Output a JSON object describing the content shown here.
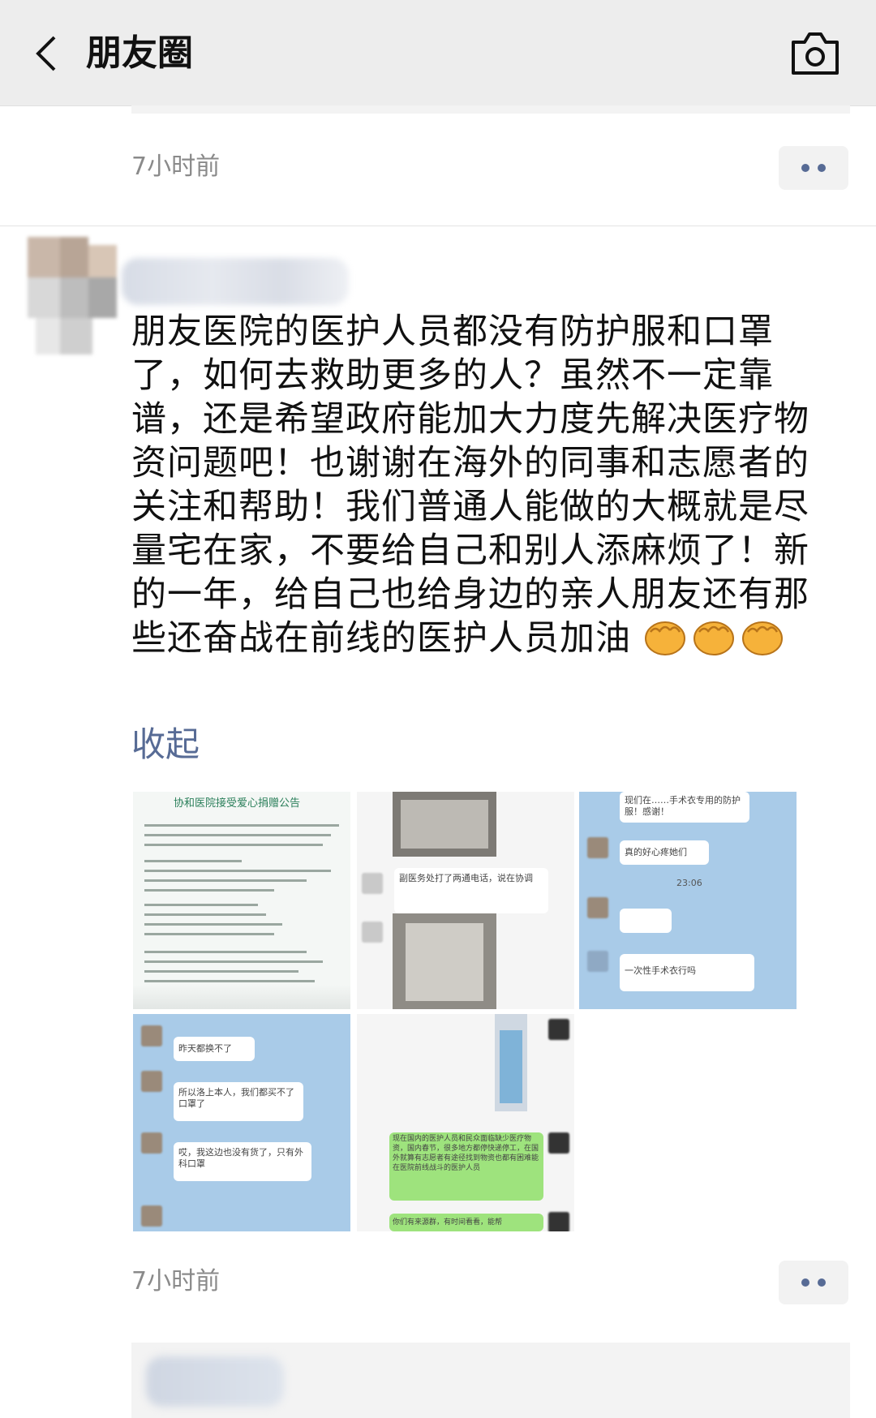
{
  "header": {
    "title": "朋友圈",
    "back_icon": "chevron-left-icon",
    "camera_icon": "camera-icon",
    "background": "#ededed"
  },
  "previous_post": {
    "time": "7小时前"
  },
  "post": {
    "text": "朋友医院的医护人员都没有防护服和口罩了，如何去救助更多的人？虽然不一定靠谱，还是希望政府能加大力度先解决医疗物资问题吧！也谢谢在海外的同事和志愿者的关注和帮助！我们普通人能做的大概就是尽量宅在家，不要给自己和别人添麻烦了！新的一年，给自己也给身边的亲人朋友还有那些还奋战在前线的医护人员加油",
    "emoji": [
      "fist-emoji",
      "fist-emoji",
      "fist-emoji"
    ],
    "collapse_label": "收起",
    "link_color": "#576b95",
    "images": {
      "img1_heading": "协和医院接受爱心捐赠公告",
      "img2_message": "副医务处打了两通电话，说在协调",
      "img3_top": "现们在……手术衣专用的防护服！感谢！",
      "img3_msg": "真的好心疼她们",
      "img3_time": "23:06",
      "img3_bottom": "一次性手术衣行吗",
      "img4_msg1": "昨天都换不了",
      "img4_msg2": "所以洛上本人，我们都买不了口罩了",
      "img4_msg3": "哎，我这边也没有货了，只有外科口罩",
      "img5_msg": "现在国内的医护人员和民众面临缺少医疗物资，国内春节，很多地方都停快递停工，在国外就算有志愿者有途径找到物资也都有困难能在医院前线战斗的医护人员",
      "img5_bottom": "你们有来源群，有时间看看，能帮"
    },
    "time": "7小时前"
  }
}
